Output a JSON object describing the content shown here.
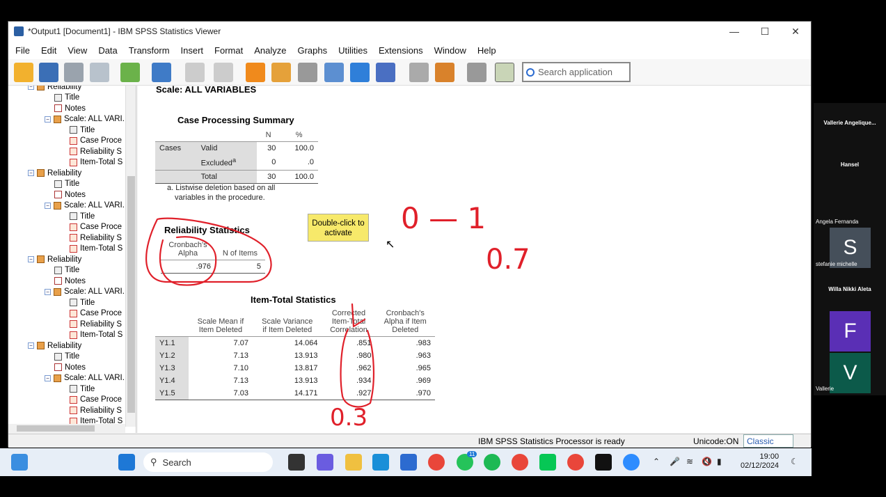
{
  "window": {
    "title": "*Output1 [Document1] - IBM SPSS Statistics Viewer",
    "min": "—",
    "max": "☐",
    "close": "✕"
  },
  "menu": [
    "File",
    "Edit",
    "View",
    "Data",
    "Transform",
    "Insert",
    "Format",
    "Analyze",
    "Graphs",
    "Utilities",
    "Extensions",
    "Window",
    "Help"
  ],
  "search": {
    "placeholder": "Search application"
  },
  "outline": {
    "top_partial": "Reliability",
    "groups": [
      {
        "items": [
          "Title",
          "Notes",
          "Scale: ALL VARI.",
          "Title",
          "Case Proce",
          "Reliability S",
          "Item-Total S"
        ]
      },
      {
        "label": "Reliability",
        "items": [
          "Title",
          "Notes",
          "Scale: ALL VARI.",
          "Title",
          "Case Proce",
          "Reliability S",
          "Item-Total S"
        ]
      },
      {
        "label": "Reliability",
        "items": [
          "Title",
          "Notes",
          "Scale: ALL VARI.",
          "Title",
          "Case Proce",
          "Reliability S",
          "Item-Total S"
        ]
      },
      {
        "label": "Reliability",
        "items": [
          "Title",
          "Notes",
          "Scale: ALL VARI.",
          "Title",
          "Case Proce",
          "Reliability S",
          "Item-Total S"
        ]
      }
    ]
  },
  "output": {
    "scale_heading": "Scale: ALL VARIABLES",
    "case_summary": {
      "title": "Case Processing Summary",
      "col_n": "N",
      "col_pct": "%",
      "row_group": "Cases",
      "rows": [
        {
          "label": "Valid",
          "n": "30",
          "pct": "100.0"
        },
        {
          "label": "Excluded",
          "sup": "a",
          "n": "0",
          "pct": ".0"
        },
        {
          "label": "Total",
          "n": "30",
          "pct": "100.0"
        }
      ],
      "footnote_1": "a. Listwise deletion based on all",
      "footnote_2": "variables in the procedure."
    },
    "tooltip_1": "Double-click to",
    "tooltip_2": "activate",
    "reliability": {
      "title": "Reliability Statistics",
      "col1_a": "Cronbach's",
      "col1_b": "Alpha",
      "col2": "N of Items",
      "alpha": ".976",
      "n_items": "5"
    },
    "item_total": {
      "title": "Item-Total Statistics",
      "headers": [
        [
          "Scale Mean if",
          "Item Deleted"
        ],
        [
          "Scale Variance",
          "if Item Deleted"
        ],
        [
          "Corrected",
          "Item-Total",
          "Correlation"
        ],
        [
          "Cronbach's",
          "Alpha if Item",
          "Deleted"
        ]
      ],
      "rows": [
        {
          "item": "Y1.1",
          "mean": "7.07",
          "var": "14.064",
          "corr": ".851",
          "alpha": ".983"
        },
        {
          "item": "Y1.2",
          "mean": "7.13",
          "var": "13.913",
          "corr": ".980",
          "alpha": ".963"
        },
        {
          "item": "Y1.3",
          "mean": "7.10",
          "var": "13.817",
          "corr": ".962",
          "alpha": ".965"
        },
        {
          "item": "Y1.4",
          "mean": "7.13",
          "var": "13.913",
          "corr": ".934",
          "alpha": ".969"
        },
        {
          "item": "Y1.5",
          "mean": "7.03",
          "var": "14.171",
          "corr": ".927",
          "alpha": ".970"
        }
      ]
    }
  },
  "annotations": {
    "range": "0 — 1",
    "threshold": "0.7",
    "item_threshold": "0.3"
  },
  "statusbar": {
    "processor": "IBM SPSS Statistics Processor is ready",
    "unicode": "Unicode:ON",
    "mode": "Classic"
  },
  "taskbar": {
    "search": "Search",
    "time": "19:00",
    "date": "02/12/2024",
    "whatsapp_badge": "11",
    "ink_color": "#e0202a"
  },
  "participants": [
    {
      "name": "Vallerie Angelique..."
    },
    {
      "name": "Hansel"
    },
    {
      "name": "Angela Fernanda"
    },
    {
      "name": "stefanie michelle",
      "initial": "S"
    },
    {
      "name": "Willa Nikki Aleta"
    },
    {
      "initial": "F"
    },
    {
      "name": "Vallerie",
      "initial": "V"
    }
  ]
}
